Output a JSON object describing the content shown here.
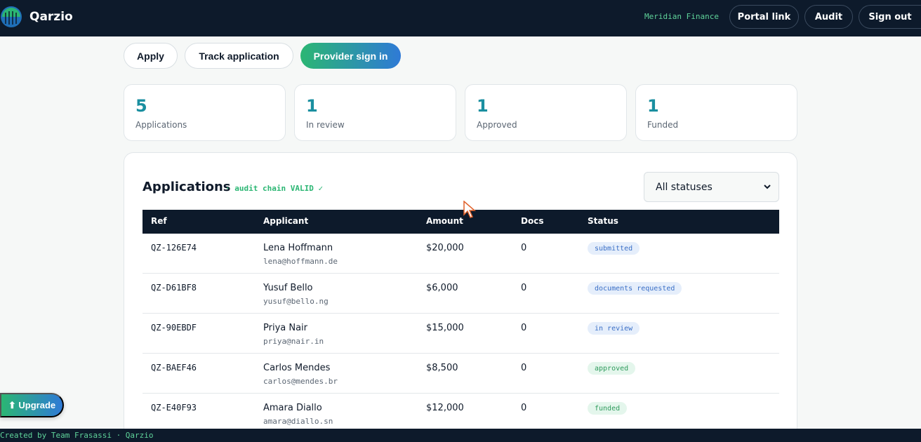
{
  "header": {
    "brand": "Qarzio",
    "tenant": "Meridian Finance",
    "buttons": {
      "portal": "Portal link",
      "audit": "Audit",
      "signout": "Sign out"
    }
  },
  "tabs": {
    "apply": "Apply",
    "track": "Track application",
    "provider": "Provider sign in"
  },
  "stats": [
    {
      "value": "5",
      "label": "Applications"
    },
    {
      "value": "1",
      "label": "In review"
    },
    {
      "value": "1",
      "label": "Approved"
    },
    {
      "value": "1",
      "label": "Funded"
    }
  ],
  "applications": {
    "title": "Applications",
    "audit_chain": "· audit chain VALID ✓",
    "filter_selected": "All statuses",
    "columns": {
      "ref": "Ref",
      "applicant": "Applicant",
      "amount": "Amount",
      "docs": "Docs",
      "status": "Status"
    },
    "rows": [
      {
        "ref": "QZ-126E74",
        "name": "Lena Hoffmann",
        "email": "lena@hoffmann.de",
        "amount": "$20,000",
        "docs": "0",
        "status": "submitted"
      },
      {
        "ref": "QZ-D61BF8",
        "name": "Yusuf Bello",
        "email": "yusuf@bello.ng",
        "amount": "$6,000",
        "docs": "0",
        "status": "documents requested"
      },
      {
        "ref": "QZ-90EBDF",
        "name": "Priya Nair",
        "email": "priya@nair.in",
        "amount": "$15,000",
        "docs": "0",
        "status": "in review"
      },
      {
        "ref": "QZ-BAEF46",
        "name": "Carlos Mendes",
        "email": "carlos@mendes.br",
        "amount": "$8,500",
        "docs": "0",
        "status": "approved"
      },
      {
        "ref": "QZ-E40F93",
        "name": "Amara Diallo",
        "email": "amara@diallo.sn",
        "amount": "$12,000",
        "docs": "0",
        "status": "funded"
      }
    ]
  },
  "upgrade": {
    "label": "⬆ Upgrade"
  },
  "footer": {
    "text": "Created by Team Frasassi · Qarzio"
  },
  "colors": {
    "navy": "#0d1a2b",
    "accent_green": "#2bb673",
    "accent_blue": "#2f7ad6",
    "stat_teal": "#1a8fa0"
  }
}
